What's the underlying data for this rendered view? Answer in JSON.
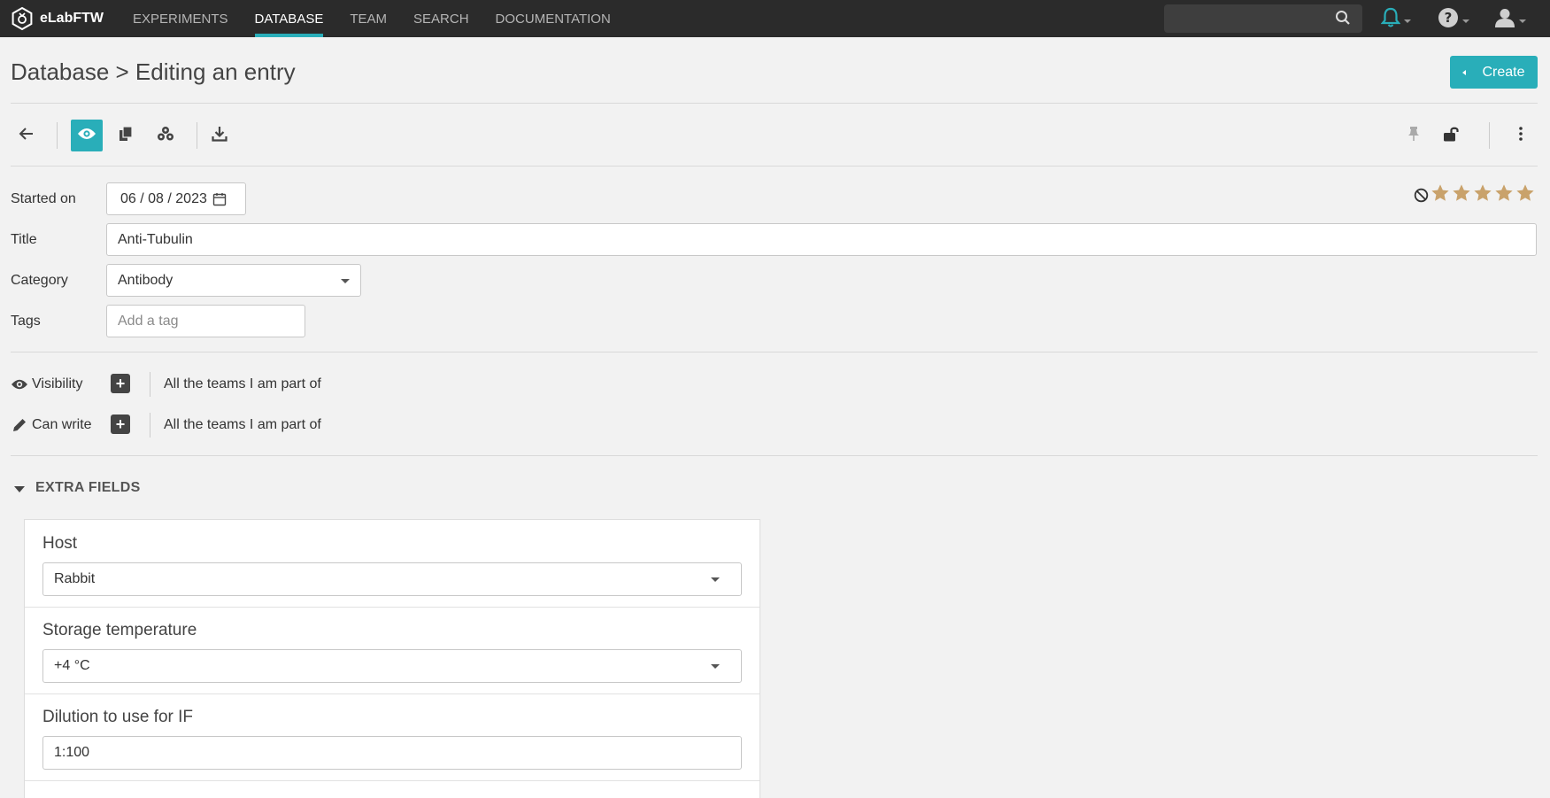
{
  "nav": {
    "brand": "eLabFTW",
    "items": [
      {
        "label": "EXPERIMENTS",
        "active": false
      },
      {
        "label": "DATABASE",
        "active": true
      },
      {
        "label": "TEAM",
        "active": false
      },
      {
        "label": "SEARCH",
        "active": false
      },
      {
        "label": "DOCUMENTATION",
        "active": false
      }
    ],
    "search_placeholder": "",
    "accent": "#29aeb9"
  },
  "page": {
    "title": "Database > Editing an entry",
    "create_label": "Create"
  },
  "toolbar": {
    "left_icons": [
      "arrow-left-icon",
      "eye-icon",
      "copy-icon",
      "boxes-icon",
      "download-icon"
    ],
    "right_icons": [
      "pin-icon",
      "unlock-icon",
      "kebab-menu-icon"
    ]
  },
  "form": {
    "started_on": {
      "label": "Started on",
      "value": "06 / 08 / 2023"
    },
    "title": {
      "label": "Title",
      "value": "Anti-Tubulin"
    },
    "category": {
      "label": "Category",
      "value": "Antibody"
    },
    "tags": {
      "label": "Tags",
      "placeholder": "Add a tag"
    },
    "rating": {
      "value": 0,
      "max": 5,
      "star_color": "#c9a26b"
    }
  },
  "permissions": {
    "visibility": {
      "label": "Visibility",
      "value": "All the teams I am part of"
    },
    "can_write": {
      "label": "Can write",
      "value": "All the teams I am part of"
    },
    "add_symbol": "+"
  },
  "extra_fields": {
    "title": "EXTRA FIELDS",
    "fields": [
      {
        "label": "Host",
        "value": "Rabbit",
        "type": "select"
      },
      {
        "label": "Storage temperature",
        "value": "+4 °C",
        "type": "select"
      },
      {
        "label": "Dilution to use for IF",
        "value": "1:100",
        "type": "text"
      }
    ]
  }
}
